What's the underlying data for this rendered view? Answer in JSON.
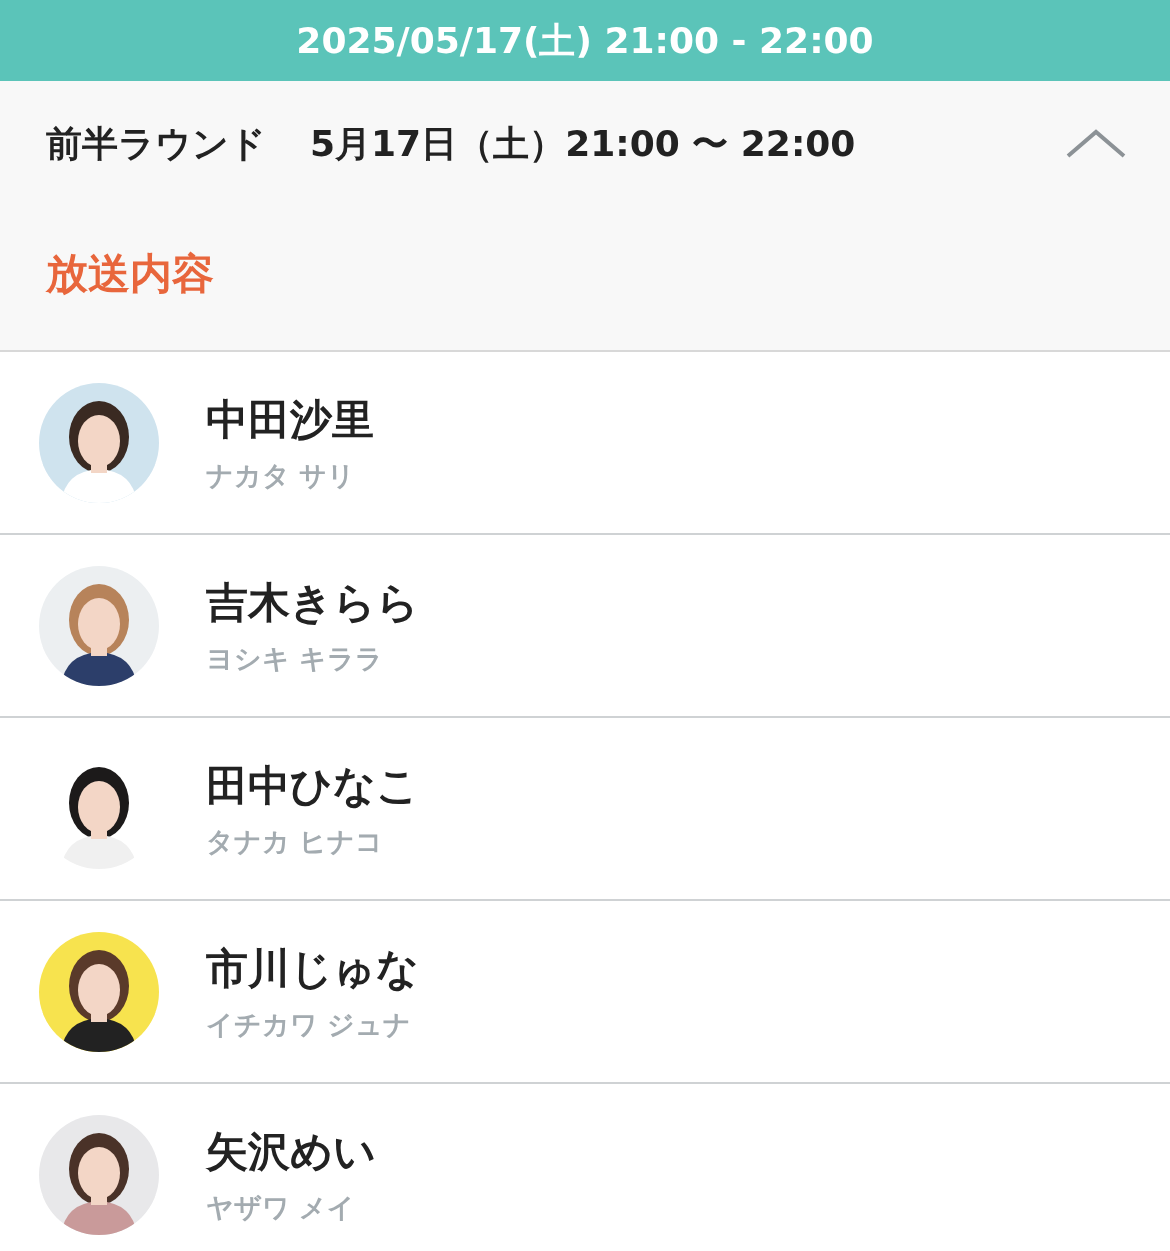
{
  "header": {
    "title": "2025/05/17(土) 21:00 - 22:00"
  },
  "round": {
    "label": "前半ラウンド",
    "time": "5月17日（土）21:00 〜 22:00",
    "expanded": true,
    "section_title": "放送内容"
  },
  "performers": [
    {
      "name": "中田沙里",
      "kana": "ナカタ サリ"
    },
    {
      "name": "吉木きらら",
      "kana": "ヨシキ キララ"
    },
    {
      "name": "田中ひなこ",
      "kana": "タナカ ヒナコ"
    },
    {
      "name": "市川じゅな",
      "kana": "イチカワ ジュナ"
    },
    {
      "name": "矢沢めい",
      "kana": "ヤザワ メイ"
    }
  ]
}
